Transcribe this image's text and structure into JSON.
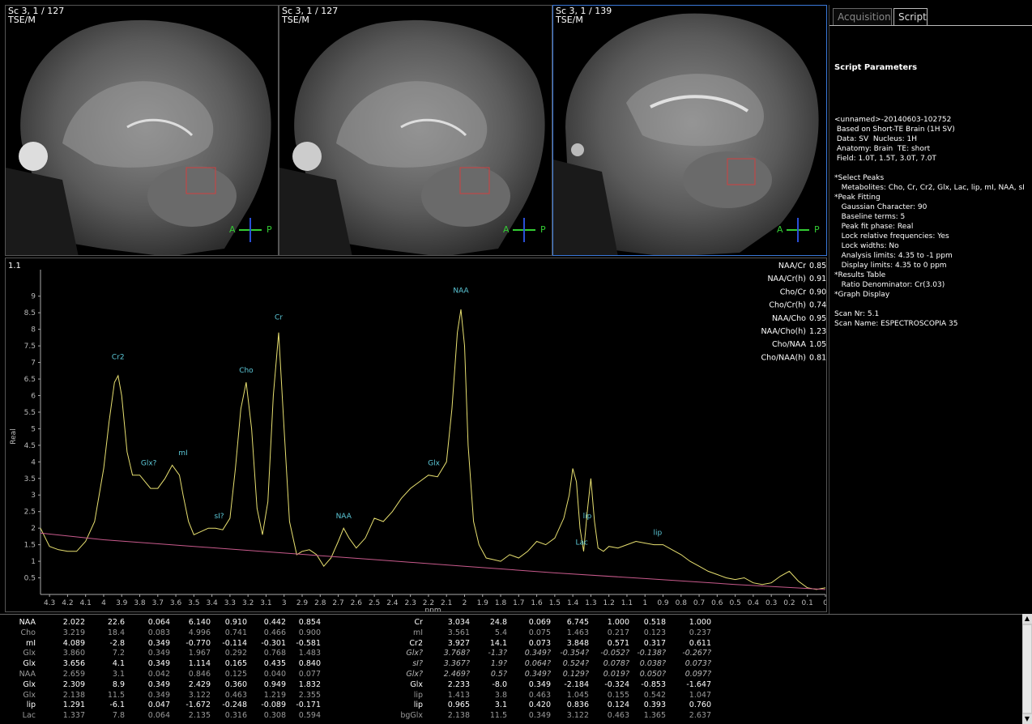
{
  "viewports": [
    {
      "label": "Sc 3, 1 / 127\nTSE/M",
      "orient_left": "A",
      "orient_right": "P"
    },
    {
      "label": "Sc 3, 1 / 127\nTSE/M",
      "orient_left": "A",
      "orient_right": "P"
    },
    {
      "label": "Sc 3, 1 / 139\nTSE/M",
      "orient_left": "A",
      "orient_right": "P"
    }
  ],
  "tabs": [
    {
      "label": "Acquisition",
      "selected": false
    },
    {
      "label": "Script",
      "selected": true
    }
  ],
  "script": {
    "title": "Script Parameters",
    "lines": [
      "<unnamed>-20140603-102752",
      " Based on Short-TE Brain (1H SV)",
      " Data: SV  Nucleus: 1H",
      " Anatomy: Brain  TE: short",
      " Field: 1.0T, 1.5T, 3.0T, 7.0T",
      "",
      "*Select Peaks",
      "   Metabolites: Cho, Cr, Cr2, Glx, Lac, lip, mI, NAA, sI",
      "*Peak Fitting",
      "   Gaussian Character: 90",
      "   Baseline terms: 5",
      "   Peak fit phase: Real",
      "   Lock relative frequencies: Yes",
      "   Lock widths: No",
      "   Analysis limits: 4.35 to -1 ppm",
      "   Display limits: 4.35 to 0 ppm",
      "*Results Table",
      "   Ratio Denominator: Cr(3.03)",
      "*Graph Display",
      "",
      "Scan Nr: 5.1",
      "Scan Name: ESPECTROSCOPIA 35"
    ]
  },
  "spectrum": {
    "corner_label": "1.1",
    "ylabel": "Real",
    "xlabel": "ppm",
    "y_ticks": [
      "0.5",
      "1",
      "1.5",
      "2",
      "2.5",
      "3",
      "3.5",
      "4",
      "4.5",
      "5",
      "5.5",
      "6",
      "6.5",
      "7",
      "7.5",
      "8",
      "8.5",
      "9"
    ],
    "x_ticks": [
      "4.3",
      "4.2",
      "4.1",
      "4",
      "3.9",
      "3.8",
      "3.7",
      "3.6",
      "3.5",
      "3.4",
      "3.3",
      "3.2",
      "3.1",
      "3",
      "2.9",
      "2.8",
      "2.7",
      "2.6",
      "2.5",
      "2.4",
      "2.3",
      "2.2",
      "2.1",
      "2",
      "1.9",
      "1.8",
      "1.7",
      "1.6",
      "1.5",
      "1.4",
      "1.3",
      "1.2",
      "1.1",
      "1",
      "0.9",
      "0.8",
      "0.7",
      "0.6",
      "0.5",
      "0.4",
      "0.3",
      "0.2",
      "0.1",
      "0"
    ],
    "ratios": [
      {
        "name": "NAA/Cr",
        "value": "0.85"
      },
      {
        "name": "NAA/Cr(h)",
        "value": "0.91"
      },
      {
        "name": "Cho/Cr",
        "value": "0.90"
      },
      {
        "name": "Cho/Cr(h)",
        "value": "0.74"
      },
      {
        "name": "NAA/Cho",
        "value": "0.95"
      },
      {
        "name": "NAA/Cho(h)",
        "value": "1.23"
      },
      {
        "name": "Cho/NAA",
        "value": "1.05"
      },
      {
        "name": "Cho/NAA(h)",
        "value": "0.81"
      }
    ],
    "peak_labels": [
      {
        "text": "Cr2",
        "ppm": 3.92,
        "y": 7.1
      },
      {
        "text": "Glx?",
        "ppm": 3.75,
        "y": 3.9
      },
      {
        "text": "mI",
        "ppm": 3.56,
        "y": 4.2
      },
      {
        "text": "sI?",
        "ppm": 3.36,
        "y": 2.3
      },
      {
        "text": "Cho",
        "ppm": 3.21,
        "y": 6.7
      },
      {
        "text": "Cr",
        "ppm": 3.03,
        "y": 8.3
      },
      {
        "text": "NAA",
        "ppm": 2.67,
        "y": 2.3
      },
      {
        "text": "Glx",
        "ppm": 2.17,
        "y": 3.9
      },
      {
        "text": "NAA",
        "ppm": 2.02,
        "y": 9.1
      },
      {
        "text": "lip",
        "ppm": 1.32,
        "y": 2.3
      },
      {
        "text": "Lac",
        "ppm": 1.35,
        "y": 1.5
      },
      {
        "text": "lip",
        "ppm": 0.93,
        "y": 1.8
      }
    ],
    "chart_data": {
      "type": "line",
      "x_range": [
        4.35,
        0
      ],
      "y_range": [
        0,
        9.8
      ],
      "xlabel": "ppm",
      "ylabel": "Real",
      "series": [
        {
          "role": "spectrum",
          "color": "#e8e070",
          "x": [
            4.35,
            4.3,
            4.25,
            4.2,
            4.15,
            4.1,
            4.05,
            4.0,
            3.97,
            3.94,
            3.92,
            3.9,
            3.87,
            3.84,
            3.8,
            3.77,
            3.74,
            3.7,
            3.66,
            3.62,
            3.58,
            3.56,
            3.53,
            3.5,
            3.46,
            3.42,
            3.38,
            3.34,
            3.3,
            3.27,
            3.24,
            3.21,
            3.18,
            3.15,
            3.12,
            3.09,
            3.06,
            3.03,
            3.0,
            2.97,
            2.93,
            2.9,
            2.86,
            2.82,
            2.78,
            2.74,
            2.7,
            2.67,
            2.64,
            2.6,
            2.55,
            2.5,
            2.45,
            2.4,
            2.35,
            2.3,
            2.25,
            2.2,
            2.15,
            2.1,
            2.07,
            2.04,
            2.02,
            2.0,
            1.98,
            1.95,
            1.92,
            1.88,
            1.84,
            1.8,
            1.75,
            1.7,
            1.65,
            1.6,
            1.55,
            1.5,
            1.45,
            1.42,
            1.4,
            1.38,
            1.36,
            1.34,
            1.32,
            1.3,
            1.28,
            1.26,
            1.23,
            1.2,
            1.15,
            1.1,
            1.05,
            1.0,
            0.95,
            0.9,
            0.85,
            0.8,
            0.75,
            0.7,
            0.65,
            0.6,
            0.55,
            0.5,
            0.45,
            0.4,
            0.35,
            0.3,
            0.25,
            0.2,
            0.15,
            0.1,
            0.05,
            0.0
          ],
          "y": [
            2.0,
            1.45,
            1.35,
            1.3,
            1.3,
            1.6,
            2.2,
            3.8,
            5.2,
            6.4,
            6.6,
            6.0,
            4.3,
            3.6,
            3.6,
            3.4,
            3.2,
            3.2,
            3.5,
            3.9,
            3.6,
            3.0,
            2.2,
            1.8,
            1.9,
            2.0,
            2.0,
            1.95,
            2.3,
            3.8,
            5.6,
            6.4,
            5.0,
            2.6,
            1.8,
            2.8,
            6.0,
            7.9,
            5.0,
            2.2,
            1.2,
            1.3,
            1.35,
            1.2,
            0.85,
            1.1,
            1.6,
            2.0,
            1.7,
            1.4,
            1.7,
            2.3,
            2.2,
            2.5,
            2.9,
            3.2,
            3.4,
            3.6,
            3.55,
            4.0,
            5.6,
            7.9,
            8.6,
            7.5,
            4.5,
            2.2,
            1.5,
            1.1,
            1.05,
            1.0,
            1.2,
            1.1,
            1.3,
            1.6,
            1.5,
            1.7,
            2.3,
            3.0,
            3.8,
            3.4,
            2.0,
            1.3,
            2.5,
            3.5,
            2.2,
            1.4,
            1.3,
            1.45,
            1.4,
            1.5,
            1.6,
            1.55,
            1.5,
            1.5,
            1.35,
            1.2,
            1.0,
            0.85,
            0.7,
            0.6,
            0.5,
            0.45,
            0.5,
            0.35,
            0.3,
            0.35,
            0.55,
            0.7,
            0.4,
            0.2,
            0.15,
            0.2
          ]
        },
        {
          "role": "baseline",
          "color": "#c85a8c",
          "x": [
            4.35,
            4.0,
            3.5,
            3.0,
            2.5,
            2.0,
            1.5,
            1.0,
            0.5,
            0.0
          ],
          "y": [
            1.85,
            1.65,
            1.45,
            1.25,
            1.05,
            0.85,
            0.65,
            0.48,
            0.3,
            0.15
          ]
        }
      ]
    }
  },
  "results_table": {
    "left": [
      {
        "name": "NAA",
        "vals": [
          "2.022",
          "22.6",
          "0.064",
          "6.140",
          "0.910",
          "0.442",
          "0.854"
        ],
        "style": ""
      },
      {
        "name": "Cho",
        "vals": [
          "3.219",
          "18.4",
          "0.083",
          "4.996",
          "0.741",
          "0.466",
          "0.900"
        ],
        "style": "dim"
      },
      {
        "name": "mI",
        "vals": [
          "4.089",
          "-2.8",
          "0.349",
          "-0.770",
          "-0.114",
          "-0.301",
          "-0.581"
        ],
        "style": ""
      },
      {
        "name": "Glx",
        "vals": [
          "3.860",
          "7.2",
          "0.349",
          "1.967",
          "0.292",
          "0.768",
          "1.483"
        ],
        "style": "dim"
      },
      {
        "name": "Glx",
        "vals": [
          "3.656",
          "4.1",
          "0.349",
          "1.114",
          "0.165",
          "0.435",
          "0.840"
        ],
        "style": ""
      },
      {
        "name": "NAA",
        "vals": [
          "2.659",
          "3.1",
          "0.042",
          "0.846",
          "0.125",
          "0.040",
          "0.077"
        ],
        "style": "dim"
      },
      {
        "name": "Glx",
        "vals": [
          "2.309",
          "8.9",
          "0.349",
          "2.429",
          "0.360",
          "0.949",
          "1.832"
        ],
        "style": ""
      },
      {
        "name": "Glx",
        "vals": [
          "2.138",
          "11.5",
          "0.349",
          "3.122",
          "0.463",
          "1.219",
          "2.355"
        ],
        "style": "dim"
      },
      {
        "name": "lip",
        "vals": [
          "1.291",
          "-6.1",
          "0.047",
          "-1.672",
          "-0.248",
          "-0.089",
          "-0.171"
        ],
        "style": ""
      },
      {
        "name": "Lac",
        "vals": [
          "1.337",
          "7.8",
          "0.064",
          "2.135",
          "0.316",
          "0.308",
          "0.594"
        ],
        "style": "dim"
      }
    ],
    "right": [
      {
        "name": "Cr",
        "vals": [
          "3.034",
          "24.8",
          "0.069",
          "6.745",
          "1.000",
          "0.518",
          "1.000"
        ],
        "style": ""
      },
      {
        "name": "mI",
        "vals": [
          "3.561",
          "5.4",
          "0.075",
          "1.463",
          "0.217",
          "0.123",
          "0.237"
        ],
        "style": "dim"
      },
      {
        "name": "Cr2",
        "vals": [
          "3.927",
          "14.1",
          "0.073",
          "3.848",
          "0.571",
          "0.317",
          "0.611"
        ],
        "style": ""
      },
      {
        "name": "Glx?",
        "vals": [
          "3.768?",
          "-1.3?",
          "0.349?",
          "-0.354?",
          "-0.052?",
          "-0.138?",
          "-0.267?"
        ],
        "style": "it"
      },
      {
        "name": "sI?",
        "vals": [
          "3.367?",
          "1.9?",
          "0.064?",
          "0.524?",
          "0.078?",
          "0.038?",
          "0.073?"
        ],
        "style": "it"
      },
      {
        "name": "Glx?",
        "vals": [
          "2.469?",
          "0.5?",
          "0.349?",
          "0.129?",
          "0.019?",
          "0.050?",
          "0.097?"
        ],
        "style": "it"
      },
      {
        "name": "Glx",
        "vals": [
          "2.233",
          "-8.0",
          "0.349",
          "-2.184",
          "-0.324",
          "-0.853",
          "-1.647"
        ],
        "style": ""
      },
      {
        "name": "lip",
        "vals": [
          "1.413",
          "3.8",
          "0.463",
          "1.045",
          "0.155",
          "0.542",
          "1.047"
        ],
        "style": "dim"
      },
      {
        "name": "lip",
        "vals": [
          "0.965",
          "3.1",
          "0.420",
          "0.836",
          "0.124",
          "0.393",
          "0.760"
        ],
        "style": ""
      },
      {
        "name": "bgGlx",
        "vals": [
          "2.138",
          "11.5",
          "0.349",
          "3.122",
          "0.463",
          "1.365",
          "2.637"
        ],
        "style": "dim"
      }
    ]
  }
}
